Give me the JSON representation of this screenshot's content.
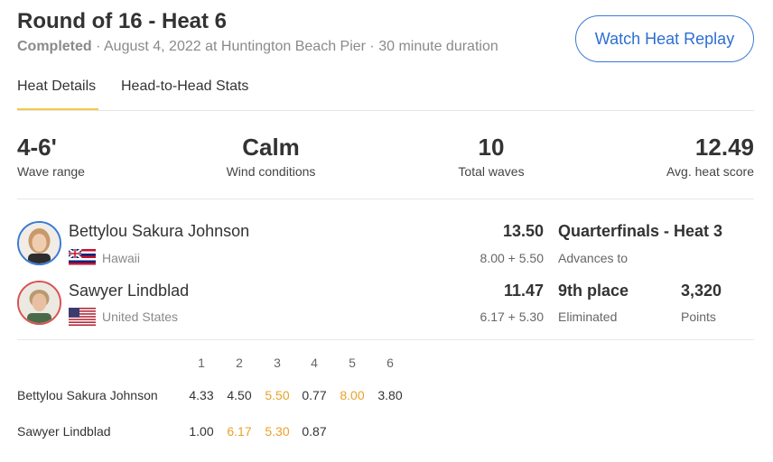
{
  "header": {
    "title": "Round of 16 - Heat 6",
    "status": "Completed",
    "details": " · August 4, 2022 at Huntington Beach Pier · 30 minute duration",
    "replay_button": "Watch Heat Replay"
  },
  "tabs": [
    {
      "label": "Heat Details",
      "active": true
    },
    {
      "label": "Head-to-Head Stats",
      "active": false
    }
  ],
  "stats": [
    {
      "value": "4-6'",
      "label": "Wave range"
    },
    {
      "value": "Calm",
      "label": "Wind conditions"
    },
    {
      "value": "10",
      "label": "Total waves"
    },
    {
      "value": "12.49",
      "label": "Avg. heat score"
    }
  ],
  "surfers": [
    {
      "name": "Bettylou Sakura Johnson",
      "country": "Hawaii",
      "flag": "hawaii-flag",
      "total": "13.50",
      "breakdown": "8.00 + 5.50",
      "result": "Quarterfinals - Heat 3",
      "result_label": "Advances to",
      "points": "",
      "points_label": "",
      "avatar_ring": "#3a7bd5"
    },
    {
      "name": "Sawyer Lindblad",
      "country": "United States",
      "flag": "usa-flag",
      "total": "11.47",
      "breakdown": "6.17 + 5.30",
      "result": "9th place",
      "result_label": "Eliminated",
      "points": "3,320",
      "points_label": "Points",
      "avatar_ring": "#d9534f"
    }
  ],
  "wave_table": {
    "headers": [
      "1",
      "2",
      "3",
      "4",
      "5",
      "6"
    ],
    "rows": [
      {
        "name": "Bettylou Sakura Johnson",
        "scores": [
          "4.33",
          "4.50",
          "5.50",
          "0.77",
          "8.00",
          "3.80"
        ],
        "counted": [
          false,
          false,
          true,
          false,
          true,
          false
        ]
      },
      {
        "name": "Sawyer Lindblad",
        "scores": [
          "1.00",
          "6.17",
          "5.30",
          "0.87"
        ],
        "counted": [
          false,
          true,
          true,
          false
        ]
      }
    ]
  },
  "colors": {
    "accent": "#2d6fd1",
    "highlight": "#e8a22a",
    "tab_underline": "#f2c94c"
  }
}
